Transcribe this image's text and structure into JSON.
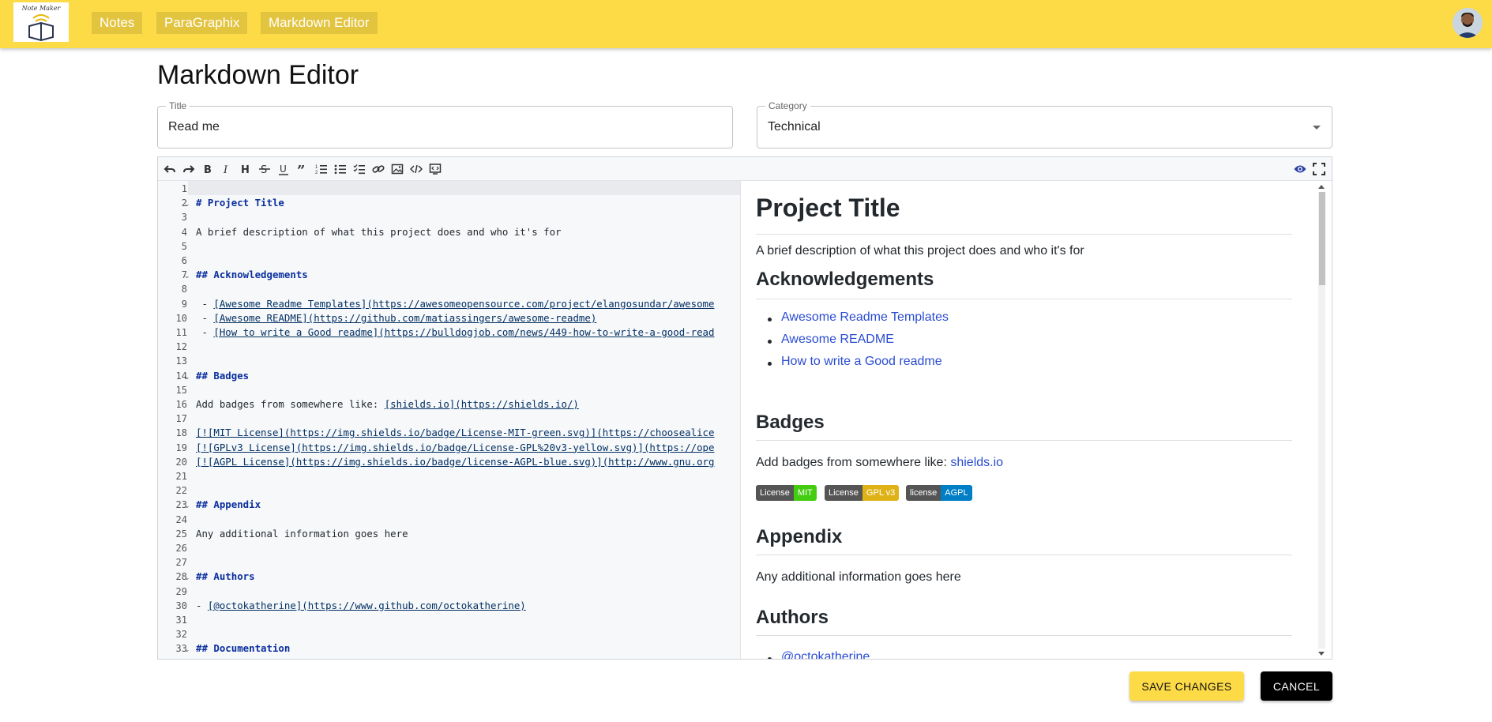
{
  "header": {
    "logo_text": "Note Maker",
    "nav": [
      {
        "label": "Notes"
      },
      {
        "label": "ParaGraphix"
      },
      {
        "label": "Markdown Editor"
      }
    ]
  },
  "page_title": "Markdown Editor",
  "title_field": {
    "label": "Title",
    "value": "Read me"
  },
  "category_field": {
    "label": "Category",
    "value": "Technical"
  },
  "toolbar": {
    "icons": [
      "undo-icon",
      "redo-icon",
      "bold-icon",
      "italic-icon",
      "heading-icon",
      "strikethrough-icon",
      "underline-icon",
      "quote-icon",
      "ordered-list-icon",
      "unordered-list-icon",
      "checklist-icon",
      "link-icon",
      "image-icon",
      "code-icon",
      "code-block-icon"
    ],
    "right_icons": [
      "preview-eye-icon",
      "fullscreen-icon"
    ],
    "preview_color": "#2a3fa3"
  },
  "code": {
    "lines": [
      "",
      "# Project Title",
      "",
      "A brief description of what this project does and who it's for",
      "",
      "",
      "## Acknowledgements",
      "",
      " - [Awesome Readme Templates](https://awesomeopensource.com/project/elangosundar/awesome",
      " - [Awesome README](https://github.com/matiassingers/awesome-readme)",
      " - [How to write a Good readme](https://bulldogjob.com/news/449-how-to-write-a-good-read",
      "",
      "",
      "## Badges",
      "",
      "Add badges from somewhere like: [shields.io](https://shields.io/)",
      "",
      "[![MIT License](https://img.shields.io/badge/License-MIT-green.svg)](https://choosealice",
      "[![GPLv3 License](https://img.shields.io/badge/License-GPL%20v3-yellow.svg)](https://ope",
      "[![AGPL License](https://img.shields.io/badge/license-AGPL-blue.svg)](http://www.gnu.org",
      "",
      "",
      "## Appendix",
      "",
      "Any additional information goes here",
      "",
      "",
      "## Authors",
      "",
      "- [@octokatherine](https://www.github.com/octokatherine)",
      "",
      "",
      "## Documentation"
    ],
    "fold_lines": [
      2,
      7,
      14,
      23,
      28,
      33
    ]
  },
  "preview": {
    "h1": "Project Title",
    "intro": "A brief description of what this project does and who it's for",
    "ack_heading": "Acknowledgements",
    "ack_items": [
      "Awesome Readme Templates",
      "Awesome README",
      "How to write a Good readme"
    ],
    "badges_heading": "Badges",
    "badges_text": "Add badges from somewhere like: ",
    "badges_link": "shields.io",
    "badges": [
      {
        "left": "License",
        "right": "MIT",
        "color": "#4c1"
      },
      {
        "left": "License",
        "right": "GPL v3",
        "color": "#dfb317"
      },
      {
        "left": "license",
        "right": "AGPL",
        "color": "#007ec6"
      }
    ],
    "appendix_heading": "Appendix",
    "appendix_text": "Any additional information goes here",
    "authors_heading": "Authors",
    "authors_items": [
      "@octokatherine"
    ]
  },
  "actions": {
    "save_label": "SAVE CHANGES",
    "cancel_label": "CANCEL"
  },
  "colors": {
    "appbar": "#fddb47",
    "nav_button": "#e3c43f",
    "heading_code": "#0b2f9e",
    "link_preview": "#2a4cd1"
  }
}
